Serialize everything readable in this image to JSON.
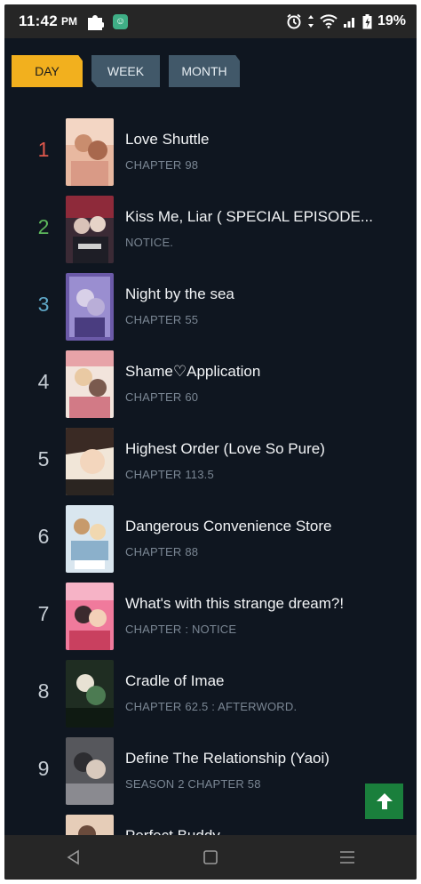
{
  "status_bar": {
    "time": "11:42",
    "ampm": "PM",
    "battery": "19%"
  },
  "tabs": [
    {
      "label": "DAY",
      "active": true
    },
    {
      "label": "WEEK",
      "active": false
    },
    {
      "label": "MONTH",
      "active": false
    }
  ],
  "list": [
    {
      "rank": "1",
      "rank_color": "#e0584c",
      "title": "Love Shuttle",
      "subtitle": "CHAPTER 98"
    },
    {
      "rank": "2",
      "rank_color": "#5db85c",
      "title": "Kiss Me, Liar ( SPECIAL EPISODE...",
      "subtitle": "NOTICE."
    },
    {
      "rank": "3",
      "rank_color": "#5fa8c8",
      "title": "Night by the sea",
      "subtitle": "CHAPTER 55"
    },
    {
      "rank": "4",
      "rank_color": "#c5ccd3",
      "title": "Shame♡Application",
      "subtitle": "CHAPTER 60"
    },
    {
      "rank": "5",
      "rank_color": "#c5ccd3",
      "title": "Highest Order (Love So Pure)",
      "subtitle": "CHAPTER 113.5"
    },
    {
      "rank": "6",
      "rank_color": "#c5ccd3",
      "title": "Dangerous Convenience Store",
      "subtitle": "CHAPTER 88"
    },
    {
      "rank": "7",
      "rank_color": "#c5ccd3",
      "title": "What's with this strange dream?!",
      "subtitle": "CHAPTER : NOTICE"
    },
    {
      "rank": "8",
      "rank_color": "#c5ccd3",
      "title": "Cradle of Imae",
      "subtitle": "CHAPTER 62.5 : AFTERWORD."
    },
    {
      "rank": "9",
      "rank_color": "#c5ccd3",
      "title": "Define The Relationship (Yaoi)",
      "subtitle": "SEASON 2 CHAPTER 58"
    },
    {
      "rank": "",
      "rank_color": "#c5ccd3",
      "title": "Perfect Buddy",
      "subtitle": ""
    }
  ],
  "icons": {
    "scroll_top": "arrow-up-icon",
    "nav_back": "back-triangle-icon",
    "nav_home": "home-square-icon",
    "nav_menu": "menu-lines-icon"
  }
}
